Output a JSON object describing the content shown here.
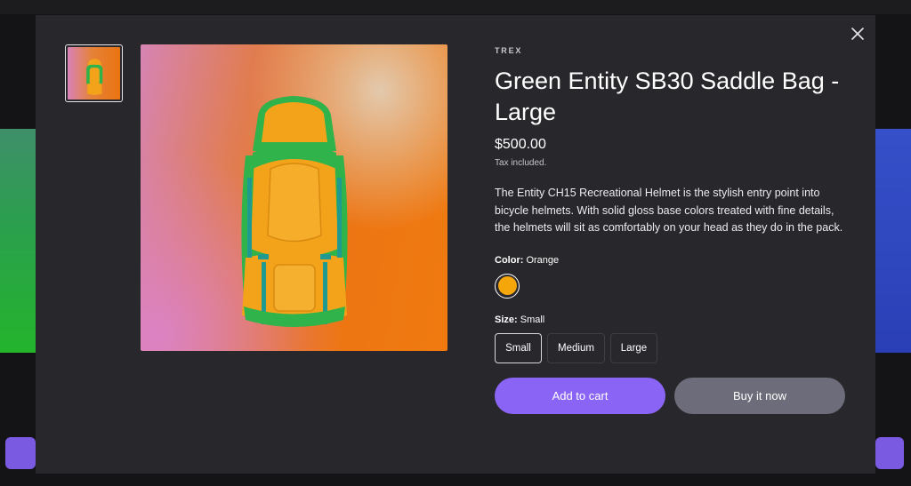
{
  "product": {
    "vendor": "TREX",
    "title": "Green Entity SB30 Saddle Bag - Large",
    "price": "$500.00",
    "tax_note": "Tax included.",
    "description": "The Entity CH15 Recreational Helmet is the stylish entry point into bicycle helmets. With solid gloss base colors treated with fine details, the helmets will sit as comfortably on your head as they do in the pack.",
    "color": {
      "label": "Color:",
      "selected": "Orange",
      "swatch_hex": "#f5a60b"
    },
    "size": {
      "label": "Size:",
      "selected": "Small",
      "options": [
        "Small",
        "Medium",
        "Large"
      ]
    },
    "add_to_cart_label": "Add to cart",
    "buy_now_label": "Buy it now"
  },
  "colors": {
    "modal_bg": "#28272c",
    "accent": "#8a64f5",
    "secondary_button": "#6d6c7a"
  },
  "icons": {
    "close": "close-icon"
  }
}
